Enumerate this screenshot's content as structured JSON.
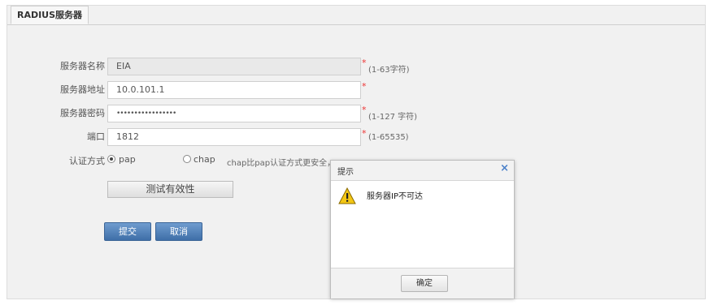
{
  "tab": {
    "label": "RADIUS服务器"
  },
  "form": {
    "server_name": {
      "label": "服务器名称",
      "value": "EIA",
      "required": "*",
      "hint": "(1-63字符)"
    },
    "server_address": {
      "label": "服务器地址",
      "value": "10.0.101.1",
      "required": "*"
    },
    "server_password": {
      "label": "服务器密码",
      "value": "•••••••••••••••••",
      "required": "*",
      "hint": "(1-127 字符)"
    },
    "port": {
      "label": "端口",
      "value": "1812",
      "required": "*",
      "hint": "(1-65535)"
    },
    "auth_method": {
      "label": "认证方式",
      "options": [
        "pap",
        "chap"
      ],
      "selected": "pap",
      "hint": "chap比pap认证方式更安全，建议选择chap"
    }
  },
  "buttons": {
    "test": "测试有效性",
    "submit": "提交",
    "cancel": "取消"
  },
  "dialog": {
    "title": "提示",
    "close": "×",
    "message": "服务器IP不可达",
    "icon": "warning-icon",
    "ok": "确定"
  }
}
